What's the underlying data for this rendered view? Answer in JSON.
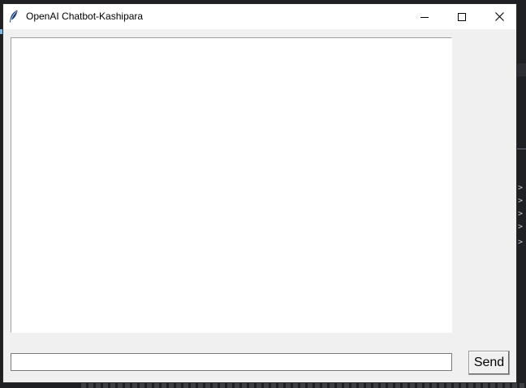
{
  "window": {
    "title": "OpenAI Chatbot-Kashipara",
    "app_icon": "feather-icon",
    "controls": {
      "minimize_icon": "minimize-icon",
      "maximize_icon": "maximize-icon",
      "close_icon": "close-icon"
    }
  },
  "chat": {
    "log_text": ""
  },
  "composer": {
    "input_value": "",
    "send_label": "Send"
  },
  "background": {
    "glyphs": [
      ">",
      ">",
      ">",
      ">",
      ">"
    ]
  },
  "colors": {
    "window_bg": "#f0f0f0",
    "titlebar_bg": "#ffffff",
    "desktop_bg": "#1f2023"
  }
}
